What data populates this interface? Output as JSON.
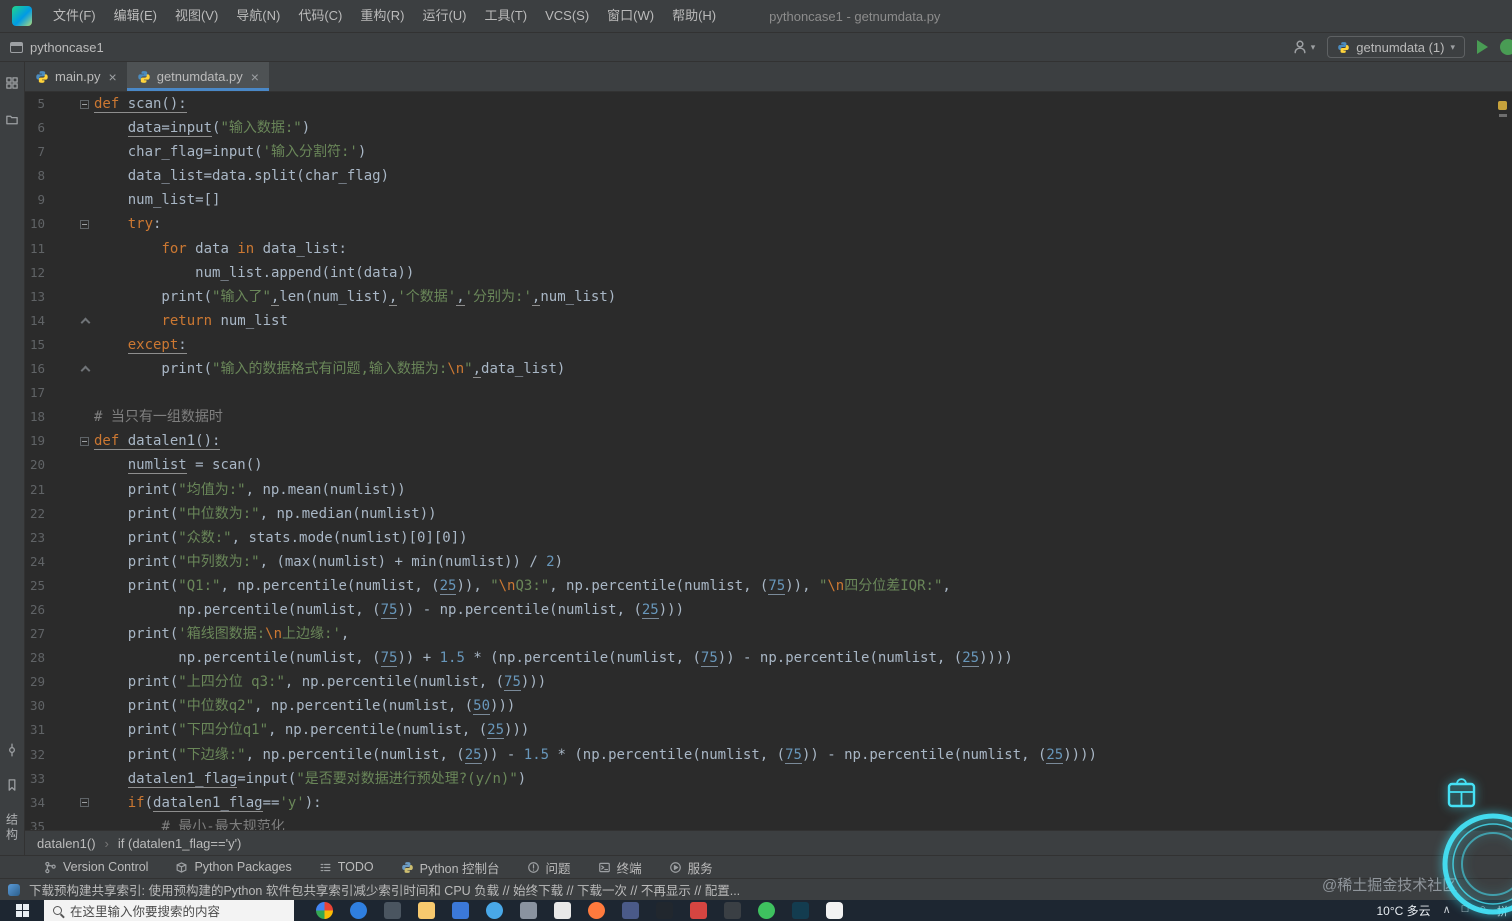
{
  "menubar": {
    "items": [
      "文件(F)",
      "编辑(E)",
      "视图(V)",
      "导航(N)",
      "代码(C)",
      "重构(R)",
      "运行(U)",
      "工具(T)",
      "VCS(S)",
      "窗口(W)",
      "帮助(H)"
    ],
    "window_title": "pythoncase1 - getnumdata.py"
  },
  "toolbar": {
    "project": "pythoncase1",
    "run_config": "getnumdata (1)"
  },
  "tabs": [
    {
      "label": "main.py",
      "active": false
    },
    {
      "label": "getnumdata.py",
      "active": true
    }
  ],
  "sidebar": {
    "structure_label": "结构"
  },
  "editor": {
    "lines": [
      {
        "n": "5",
        "fold": "start",
        "tokens": [
          [
            "k ul",
            "def "
          ],
          [
            "d ul",
            "scan():"
          ]
        ]
      },
      {
        "n": "6",
        "fold": "",
        "tokens": [
          [
            "d",
            "    "
          ],
          [
            "d ul",
            "data=input"
          ],
          [
            "d",
            "("
          ],
          [
            "s",
            "\"输入数据:\""
          ],
          [
            "d",
            ")"
          ]
        ]
      },
      {
        "n": "7",
        "fold": "",
        "tokens": [
          [
            "d",
            "    char_flag=input("
          ],
          [
            "s",
            "'输入分割符:'"
          ],
          [
            "d",
            ")"
          ]
        ]
      },
      {
        "n": "8",
        "fold": "",
        "tokens": [
          [
            "d",
            "    data_list=data.split(char_flag)"
          ]
        ]
      },
      {
        "n": "9",
        "fold": "",
        "tokens": [
          [
            "d",
            "    num_list=[]"
          ]
        ]
      },
      {
        "n": "10",
        "fold": "start",
        "tokens": [
          [
            "d",
            "    "
          ],
          [
            "k",
            "try"
          ],
          [
            "d",
            ":"
          ]
        ]
      },
      {
        "n": "11",
        "fold": "",
        "tokens": [
          [
            "d",
            "        "
          ],
          [
            "k",
            "for "
          ],
          [
            "d",
            "data "
          ],
          [
            "k",
            "in "
          ],
          [
            "d",
            "data_list:"
          ]
        ]
      },
      {
        "n": "12",
        "fold": "",
        "tokens": [
          [
            "d",
            "            num_list.append(int(data))"
          ]
        ]
      },
      {
        "n": "13",
        "fold": "",
        "tokens": [
          [
            "d",
            "        print("
          ],
          [
            "s",
            "\"输入了\""
          ],
          [
            "d ul",
            ","
          ],
          [
            "d",
            "len(num_list)"
          ],
          [
            "d ul",
            ","
          ],
          [
            "s",
            "'个数据'"
          ],
          [
            "d ul",
            ","
          ],
          [
            "s",
            "'分别为:'"
          ],
          [
            "d ul",
            ","
          ],
          [
            "d",
            "num_list)"
          ]
        ]
      },
      {
        "n": "14",
        "fold": "end",
        "tokens": [
          [
            "d",
            "        "
          ],
          [
            "k",
            "return "
          ],
          [
            "d",
            "num_list"
          ]
        ]
      },
      {
        "n": "15",
        "fold": "",
        "tokens": [
          [
            "d",
            "    "
          ],
          [
            "k ul",
            "except"
          ],
          [
            "d ul",
            ":"
          ]
        ]
      },
      {
        "n": "16",
        "fold": "end",
        "tokens": [
          [
            "d",
            "        print("
          ],
          [
            "s",
            "\"输入的数据格式有问题,输入数据为:"
          ],
          [
            "e",
            "\\n"
          ],
          [
            "s",
            "\""
          ],
          [
            "d ul",
            ","
          ],
          [
            "d",
            "data_list)"
          ]
        ]
      },
      {
        "n": "17",
        "fold": "",
        "tokens": []
      },
      {
        "n": "18",
        "fold": "",
        "tokens": [
          [
            "c",
            "# 当只有一组数据时"
          ]
        ]
      },
      {
        "n": "19",
        "fold": "start",
        "tokens": [
          [
            "k ul",
            "def "
          ],
          [
            "d ul",
            "datalen1():"
          ]
        ]
      },
      {
        "n": "20",
        "fold": "",
        "tokens": [
          [
            "d",
            "    "
          ],
          [
            "d ul",
            "numlist"
          ],
          [
            "d",
            " = scan()"
          ]
        ]
      },
      {
        "n": "21",
        "fold": "",
        "tokens": [
          [
            "d",
            "    print("
          ],
          [
            "s",
            "\"均值为:\""
          ],
          [
            "d",
            ", np.mean(numlist))"
          ]
        ]
      },
      {
        "n": "22",
        "fold": "",
        "tokens": [
          [
            "d",
            "    print("
          ],
          [
            "s",
            "\"中位数为:\""
          ],
          [
            "d",
            ", np.median(numlist))"
          ]
        ]
      },
      {
        "n": "23",
        "fold": "",
        "tokens": [
          [
            "d",
            "    print("
          ],
          [
            "s",
            "\"众数:\""
          ],
          [
            "d",
            ", stats.mode(numlist)[0][0])"
          ]
        ]
      },
      {
        "n": "24",
        "fold": "",
        "tokens": [
          [
            "d",
            "    print("
          ],
          [
            "s",
            "\"中列数为:\""
          ],
          [
            "d",
            ", (max(numlist) + min(numlist)) / "
          ],
          [
            "nb",
            "2"
          ],
          [
            "d",
            ")"
          ]
        ]
      },
      {
        "n": "25",
        "fold": "",
        "tokens": [
          [
            "d",
            "    print("
          ],
          [
            "s",
            "\"Q1:\""
          ],
          [
            "d",
            ", np.percentile(numlist, ("
          ],
          [
            "n",
            "25"
          ],
          [
            "d",
            ")), "
          ],
          [
            "s",
            "\""
          ],
          [
            "e",
            "\\n"
          ],
          [
            "s",
            "Q3:\""
          ],
          [
            "d",
            ", np.percentile(numlist, ("
          ],
          [
            "n",
            "75"
          ],
          [
            "d",
            ")), "
          ],
          [
            "s",
            "\""
          ],
          [
            "e",
            "\\n"
          ],
          [
            "s",
            "四分位差IQR:\""
          ],
          [
            "d",
            ","
          ]
        ]
      },
      {
        "n": "26",
        "fold": "",
        "tokens": [
          [
            "d",
            "          np.percentile(numlist, ("
          ],
          [
            "n",
            "75"
          ],
          [
            "d",
            ")) - np.percentile(numlist, ("
          ],
          [
            "n",
            "25"
          ],
          [
            "d",
            ")))"
          ]
        ]
      },
      {
        "n": "27",
        "fold": "",
        "tokens": [
          [
            "d",
            "    print("
          ],
          [
            "s",
            "'箱线图数据:"
          ],
          [
            "e",
            "\\n"
          ],
          [
            "s",
            "上边缘:'"
          ],
          [
            "d",
            ","
          ]
        ]
      },
      {
        "n": "28",
        "fold": "",
        "tokens": [
          [
            "d",
            "          np.percentile(numlist, ("
          ],
          [
            "n",
            "75"
          ],
          [
            "d",
            ")) + "
          ],
          [
            "nb",
            "1.5"
          ],
          [
            "d",
            " * (np.percentile(numlist, ("
          ],
          [
            "n",
            "75"
          ],
          [
            "d",
            ")) - np.percentile(numlist, ("
          ],
          [
            "n",
            "25"
          ],
          [
            "d",
            "))))"
          ]
        ]
      },
      {
        "n": "29",
        "fold": "",
        "tokens": [
          [
            "d",
            "    print("
          ],
          [
            "s",
            "\"上四分位 q3:\""
          ],
          [
            "d",
            ", np.percentile(numlist, ("
          ],
          [
            "n",
            "75"
          ],
          [
            "d",
            ")))"
          ]
        ]
      },
      {
        "n": "30",
        "fold": "",
        "tokens": [
          [
            "d",
            "    print("
          ],
          [
            "s",
            "\"中位数q2\""
          ],
          [
            "d",
            ", np.percentile(numlist, ("
          ],
          [
            "n",
            "50"
          ],
          [
            "d",
            ")))"
          ]
        ]
      },
      {
        "n": "31",
        "fold": "",
        "tokens": [
          [
            "d",
            "    print("
          ],
          [
            "s",
            "\"下四分位q1\""
          ],
          [
            "d",
            ", np.percentile(numlist, ("
          ],
          [
            "n",
            "25"
          ],
          [
            "d",
            ")))"
          ]
        ]
      },
      {
        "n": "32",
        "fold": "",
        "tokens": [
          [
            "d",
            "    print("
          ],
          [
            "s",
            "\"下边缘:\""
          ],
          [
            "d",
            ", np.percentile(numlist, ("
          ],
          [
            "n",
            "25"
          ],
          [
            "d",
            ")) - "
          ],
          [
            "nb",
            "1.5"
          ],
          [
            "d",
            " * (np.percentile(numlist, ("
          ],
          [
            "n",
            "75"
          ],
          [
            "d",
            ")) - np.percentile(numlist, ("
          ],
          [
            "n",
            "25"
          ],
          [
            "d",
            "))))"
          ]
        ]
      },
      {
        "n": "33",
        "fold": "",
        "tokens": [
          [
            "d",
            "    "
          ],
          [
            "d ul",
            "datalen1_flag"
          ],
          [
            "d",
            "=input("
          ],
          [
            "s",
            "\"是否要对数据进行预处理?(y/n)\""
          ],
          [
            "d",
            ")"
          ]
        ]
      },
      {
        "n": "34",
        "fold": "start",
        "tokens": [
          [
            "d",
            "    "
          ],
          [
            "k",
            "if"
          ],
          [
            "d",
            "("
          ],
          [
            "d ul",
            "datalen1_flag"
          ],
          [
            "d",
            "=="
          ],
          [
            "s",
            "'y'"
          ],
          [
            "d",
            "):"
          ]
        ]
      },
      {
        "n": "35",
        "fold": "",
        "tokens": [
          [
            "d",
            "        "
          ],
          [
            "c",
            "# 最小-最大规范化"
          ]
        ]
      }
    ]
  },
  "breadcrumb": {
    "items": [
      "datalen1()",
      "if (datalen1_flag=='y')"
    ]
  },
  "tool_windows": [
    {
      "icon": "branch",
      "label": "Version Control"
    },
    {
      "icon": "package",
      "label": "Python Packages"
    },
    {
      "icon": "todo",
      "label": "TODO"
    },
    {
      "icon": "pyconsole",
      "label": "Python 控制台"
    },
    {
      "icon": "problems",
      "label": "问题"
    },
    {
      "icon": "terminal",
      "label": "终端"
    },
    {
      "icon": "services",
      "label": "服务"
    }
  ],
  "statusbar": {
    "message": "下载预构建共享索引: 使用预构建的Python 软件包共享索引减少索引时间和 CPU 负载 // 始终下载 // 下载一次 // 不再显示 // 配置..."
  },
  "watermark": "@稀土掘金技术社区",
  "taskbar": {
    "search_placeholder": "在这里输入你要搜索的内容",
    "weather": "10°C 多云",
    "icons": [
      {
        "shape": "circle",
        "color": "conic"
      },
      {
        "shape": "circle",
        "color": "#2F7FE0"
      },
      {
        "shape": "square",
        "color": "#4A5560"
      },
      {
        "shape": "square",
        "color": "#F7C96E"
      },
      {
        "shape": "square",
        "color": "#3B78D8"
      },
      {
        "shape": "circle",
        "color": "#49A8E8"
      },
      {
        "shape": "square",
        "color": "#8A93A0"
      },
      {
        "shape": "square",
        "color": "#E8E8E8"
      },
      {
        "shape": "circle",
        "color": "#FF7A3D"
      },
      {
        "shape": "square",
        "color": "#4A5A88"
      },
      {
        "shape": "square",
        "color": "#21272E"
      },
      {
        "shape": "square",
        "color": "#D64541"
      },
      {
        "shape": "square",
        "color": "#3A3F44"
      },
      {
        "shape": "circle",
        "color": "#3EC15F"
      },
      {
        "shape": "square",
        "color": "#133C4F"
      },
      {
        "shape": "pill",
        "color": "#F2F2F2"
      }
    ],
    "tray": [
      "∧",
      "□",
      "○",
      "拼"
    ]
  },
  "colors": {
    "accent_blue": "#4A88C7",
    "run_green": "#499C54",
    "neon_cyan": "#45E1F5",
    "editor_bg": "#2B2B2B",
    "ui_bg": "#3C3F41"
  }
}
